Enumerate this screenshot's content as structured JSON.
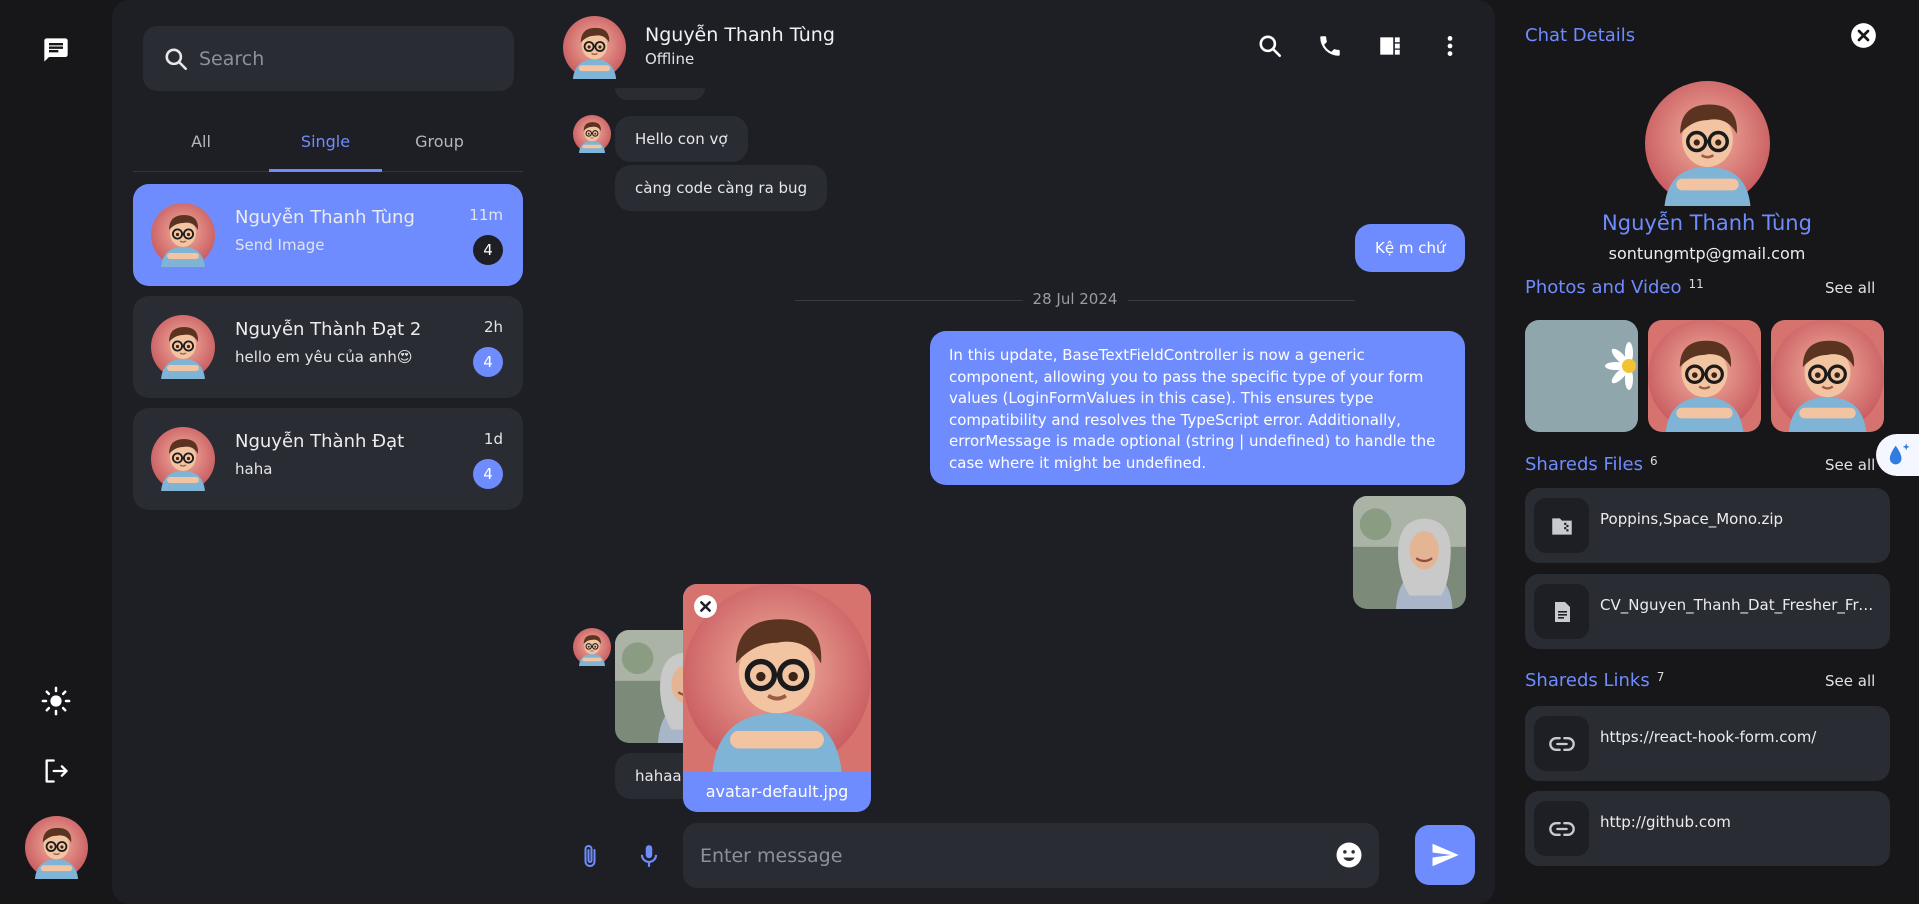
{
  "nav": {
    "icons": [
      "chat-icon",
      "sun-icon",
      "logout-icon"
    ]
  },
  "search": {
    "placeholder": "Search"
  },
  "tabs": [
    {
      "label": "All"
    },
    {
      "label": "Single"
    },
    {
      "label": "Group"
    }
  ],
  "active_tab": "Single",
  "conversations": [
    {
      "name": "Nguyễn Thanh Tùng",
      "last": "Send Image",
      "time": "11m",
      "unread": "4"
    },
    {
      "name": "Nguyễn Thành Đạt 2",
      "last": "hello em yêu của anh😍",
      "time": "2h",
      "unread": "4"
    },
    {
      "name": "Nguyễn Thành Đạt",
      "last": "haha",
      "time": "1d",
      "unread": "4"
    }
  ],
  "chat_header": {
    "name": "Nguyễn Thanh Tùng",
    "status": "Offline"
  },
  "messages": {
    "m1": "Hello con vợ",
    "m2": "càng code càng ra bug",
    "m3": "Kệ m chứ",
    "date_sep": "28 Jul 2024",
    "m4": "In this update, BaseTextFieldController is now a generic component, allowing you to pass the specific type of your form values (LoginFormValues in this case). This ensures type compatibility and resolves the TypeScript error. Additionally, errorMessage is made optional (string | undefined) to handle the case where it might be undefined.",
    "m5": "hahaa"
  },
  "attachment_preview": {
    "filename": "avatar-default.jpg"
  },
  "composer": {
    "placeholder": "Enter message"
  },
  "details": {
    "title": "Chat Details",
    "name": "Nguyễn Thanh Tùng",
    "email": "sontungmtp@gmail.com",
    "photos": {
      "label": "Photos and Video",
      "count": "11",
      "see_all": "See all"
    },
    "files": {
      "label": "Shareds Files",
      "count": "6",
      "see_all": "See all",
      "items": [
        {
          "name": "Poppins,Space_Mono.zip",
          "icon": "zip-file-icon"
        },
        {
          "name": "CV_Nguyen_Thanh_Dat_Fresher_Frontend.pdf",
          "icon": "document-icon"
        }
      ]
    },
    "links": {
      "label": "Shareds Links",
      "count": "7",
      "see_all": "See all",
      "items": [
        {
          "url": "https://react-hook-form.com/",
          "icon": "link-icon"
        },
        {
          "url": "http://github.com",
          "icon": "link-icon"
        }
      ]
    }
  },
  "colors": {
    "accent": "#6f8cff",
    "panel": "#1e1f25",
    "card": "#2a2c33",
    "background": "#17171a"
  }
}
